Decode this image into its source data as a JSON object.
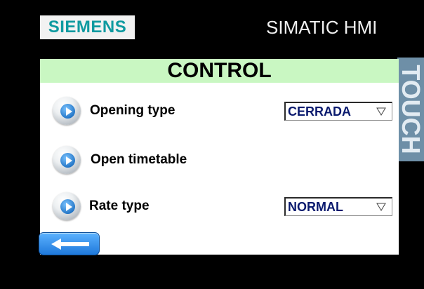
{
  "header": {
    "brand": "SIEMENS",
    "device_title": "SIMATIC HMI",
    "touch_label": "TOUCH"
  },
  "screen": {
    "title": "CONTROL",
    "rows": [
      {
        "label": "Opening type",
        "select_value": "CERRADA",
        "icon": "play-circle-icon"
      },
      {
        "label": "Open timetable",
        "icon": "play-circle-icon"
      },
      {
        "label": "Rate type",
        "select_value": "NORMAL",
        "icon": "play-circle-icon"
      }
    ],
    "back_icon": "arrow-left-icon"
  },
  "colors": {
    "brand": "#0f9aa0",
    "header_band": "#c9f7c2",
    "select_text": "#0a1a6e",
    "back_button": "#2f8ff0",
    "touch_strip": "#6e8fa7"
  }
}
